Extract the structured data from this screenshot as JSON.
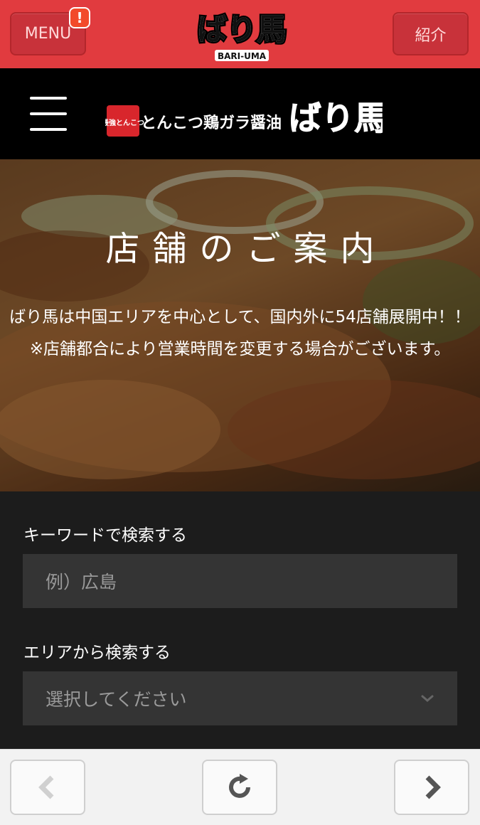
{
  "topbar": {
    "menu_label": "MENU",
    "badge": "!",
    "intro_label": "紹介",
    "logo_text": "ばり馬",
    "logo_sub": "BARI-UMA"
  },
  "site_header": {
    "logo_tag": "最強とんこつ",
    "logo_tagline": "とんこつ鶏ガラ醤油",
    "logo_name": "ばり馬"
  },
  "hero": {
    "title": "店舗のご案内",
    "description_1": "ばり馬は中国エリアを中心として、国内外に54店舗展開中！！",
    "description_2": "※店舗都合により営業時間を変更する場合がございます。"
  },
  "search": {
    "keyword_label": "キーワードで検索する",
    "keyword_placeholder": "例）広島",
    "area_label": "エリアから検索する",
    "area_selected": "選択してください"
  },
  "toolbar": {
    "icons": [
      "chevron-left-icon",
      "reload-icon",
      "chevron-right-icon"
    ]
  },
  "colors": {
    "brand_red": "#e13b3f",
    "header_black": "#000000",
    "panel_dark": "#1c1c1c",
    "field_bg": "#343434"
  }
}
